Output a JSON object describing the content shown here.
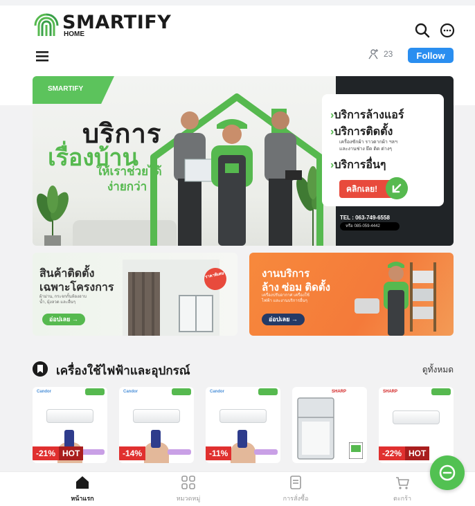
{
  "brand": {
    "name": "SMARTIFY",
    "sub": "HOME"
  },
  "header": {
    "followers_count": "23",
    "follow_label": "Follow"
  },
  "hero": {
    "brand_tag": "SMARTIFY",
    "headline_1": "บริการ",
    "headline_2": "เรื่องบ้าน",
    "headline_3": "ให้เราช่วยได้",
    "headline_4": "ง่ายกว่า",
    "services": [
      "บริการล้างแอร์",
      "บริการติดตั้ง",
      "บริการอื่นๆ"
    ],
    "install_detail_1": "เครื่องซักผ้า ราวตากผ้า ฯลฯ",
    "install_detail_2": "และงานช่าง ยึด ติด ต่างๆ",
    "cta_label": "คลิกเลย!",
    "tel_1": "TEL : 063-749-6558",
    "tel_2": "หรือ 085-059-4442"
  },
  "promos": {
    "left": {
      "title_1": "สินค้าติดตั้ง",
      "title_2": "เฉพาะโครงการ",
      "desc": "ผ้าม่าน, กระจกกั้นห้องอาบน้ำ, มุ้งลวด และอื่นๆ",
      "sticker": "ราคาพิเศษ",
      "button": "อ่อปเลย →"
    },
    "right": {
      "title_1": "งานบริการ",
      "title_2": "ล้าง ซ่อม ติดตั้ง",
      "desc": "เครื่องปรับอากาศ เครื่องใช้ไฟฟ้า และงานบริการอื่นๆ",
      "button": "อ่อปเลย →"
    }
  },
  "section": {
    "title": "เครื่องใช้ไฟฟ้าและอุปกรณ์",
    "see_all": "ดูทั้งหมด"
  },
  "products": [
    {
      "brand": "Candor",
      "discount": "-21%",
      "hot": "HOT"
    },
    {
      "brand": "Candor",
      "discount": "-14%",
      "hot": ""
    },
    {
      "brand": "Candor",
      "discount": "-11%",
      "hot": ""
    },
    {
      "brand": "SHARP",
      "discount": "",
      "hot": ""
    },
    {
      "brand": "SHARP",
      "discount": "-22%",
      "hot": "HOT"
    }
  ],
  "bottom_nav": [
    {
      "label": "หน้าแรก",
      "icon": "home-icon",
      "active": true
    },
    {
      "label": "หมวดหมู่",
      "icon": "grid-icon",
      "active": false
    },
    {
      "label": "การสั่งซื้อ",
      "icon": "receipt-icon",
      "active": false
    },
    {
      "label": "ตะกร้า",
      "icon": "cart-icon",
      "active": false
    }
  ],
  "colors": {
    "brand_green": "#56b94f",
    "follow_blue": "#2a8ef0",
    "discount_red": "#e0302f",
    "hot_red": "#a91d1d",
    "promo_orange": "#f47a3a"
  }
}
